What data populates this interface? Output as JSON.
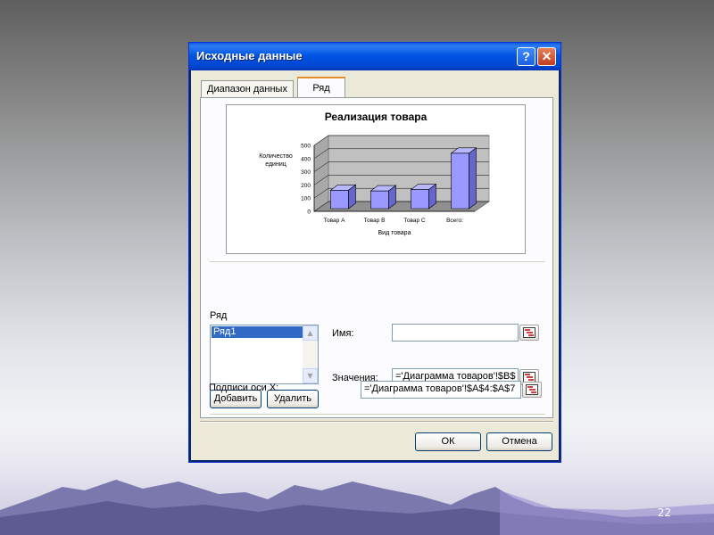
{
  "dialog": {
    "title": "Исходные данные",
    "help_symbol": "?",
    "close_symbol": "✕"
  },
  "tabs": [
    {
      "label": "Диапазон данных",
      "active": false
    },
    {
      "label": "Ряд",
      "active": true
    }
  ],
  "chart_data": {
    "type": "bar",
    "title": "Реализация товара",
    "ylabel": "Количество единиц",
    "xlabel": "Вид товара",
    "categories": [
      "Товар А",
      "Товар В",
      "Товар С",
      "Всего:"
    ],
    "values": [
      140,
      135,
      145,
      420
    ],
    "ylim": [
      0,
      500
    ],
    "yticks": [
      0,
      100,
      200,
      300,
      400,
      500
    ],
    "grid": true,
    "style": "3d",
    "bar_color": "#9999ff"
  },
  "series_section": {
    "label": "Ряд",
    "items": [
      "Ряд1"
    ],
    "add_button": "Добавить",
    "remove_button": "Удалить"
  },
  "fields": {
    "name_label": "Имя:",
    "name_value": "",
    "values_label": "Значения:",
    "values_value": "='Диаграмма товаров'!$B$",
    "x_labels_label": "Подписи оси X:",
    "x_labels_value": "='Диаграмма товаров'!$A$4:$A$7"
  },
  "footer": {
    "ok": "ОК",
    "cancel": "Отмена"
  },
  "slide": {
    "page_number": "22"
  }
}
